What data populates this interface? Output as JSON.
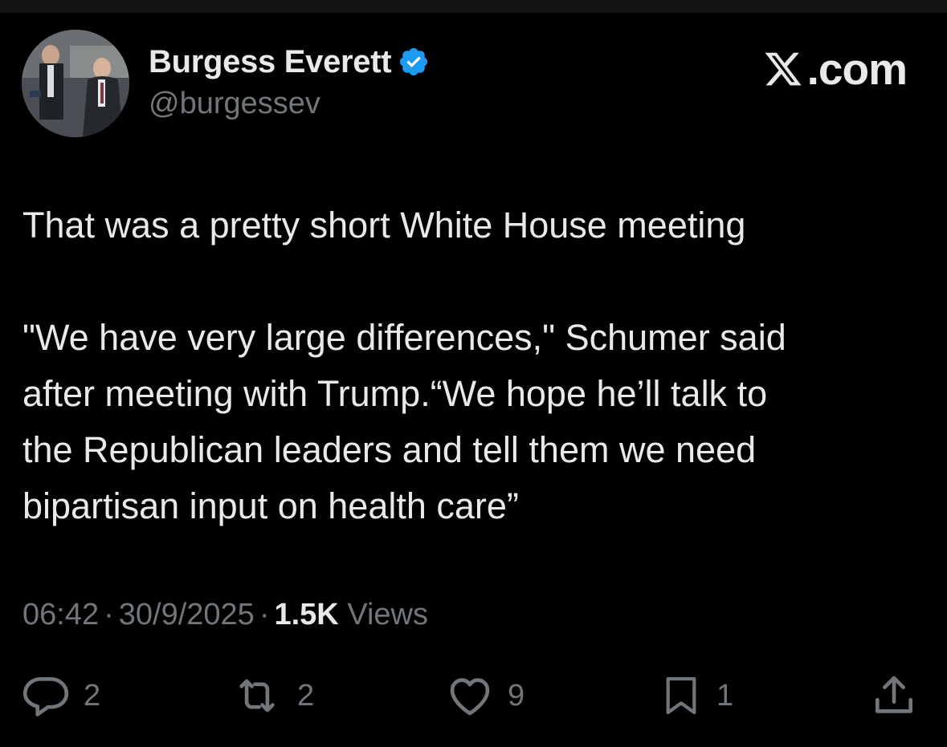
{
  "author": {
    "display_name": "Burgess Everett",
    "handle": "@burgessev",
    "verified_icon": "verified-badge-icon"
  },
  "site": {
    "label": ".com",
    "logo_icon": "x-logo-icon"
  },
  "tweet": {
    "line1": "That was a pretty short White House meeting",
    "line2": "\"We have very large differences,\" Schumer said",
    "line3": "after meeting with Trump.“We hope he’ll talk to",
    "line4": "the Republican leaders and tell them we need",
    "line5": "bipartisan input on health care”"
  },
  "meta": {
    "time": "06:42",
    "date": "30/9/2025",
    "separator": "·",
    "views_count": "1.5K",
    "views_label": "Views"
  },
  "actions": {
    "reply_count": "2",
    "retweet_count": "2",
    "like_count": "9",
    "bookmark_count": "1"
  },
  "colors": {
    "background": "#000000",
    "text_primary": "#e7e9ea",
    "text_secondary": "#71767b",
    "verified_blue": "#1d9bf0"
  }
}
